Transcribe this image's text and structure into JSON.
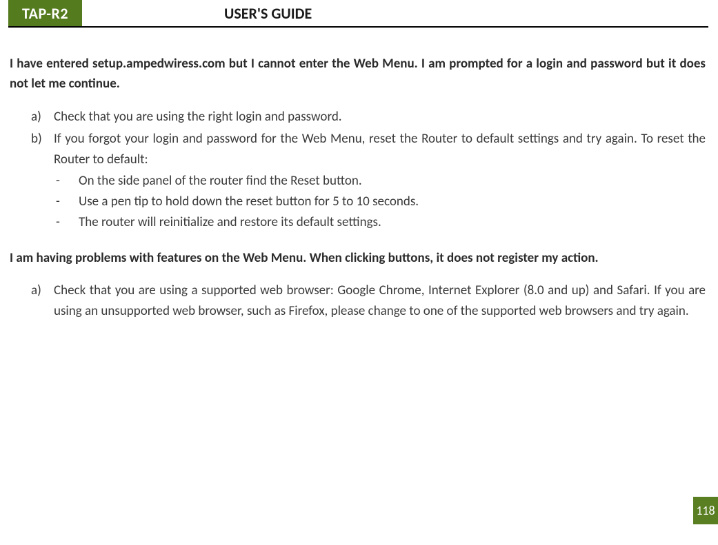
{
  "header": {
    "product": "TAP-R2",
    "title": "USER'S GUIDE"
  },
  "sections": [
    {
      "heading": "I have entered setup.ampedwiress.com but I cannot enter the Web Menu.  I am prompted for a login and password but it does not let me continue.",
      "items": [
        {
          "marker": "a)",
          "text": "Check that you are using the right login and password."
        },
        {
          "marker": "b)",
          "text": "If you forgot your login and password for the Web Menu, reset the Router to default settings and try again. To reset the Router to default:",
          "sub": [
            "On the side panel of the router find the Reset button.",
            "Use a pen tip to hold down the reset button for 5 to 10 seconds.",
            "The router will reinitialize and restore its default settings."
          ]
        }
      ]
    },
    {
      "heading": "I am having problems with features on the Web Menu.  When clicking buttons, it does not register my action.",
      "items": [
        {
          "marker": "a)",
          "text": "Check that you are using a supported web browser: Google Chrome, Internet Explorer (8.0 and up) and Safari. If you are using an unsupported web browser, such as Firefox, please change to one of the supported web browsers and try again."
        }
      ]
    }
  ],
  "page_number": "118"
}
